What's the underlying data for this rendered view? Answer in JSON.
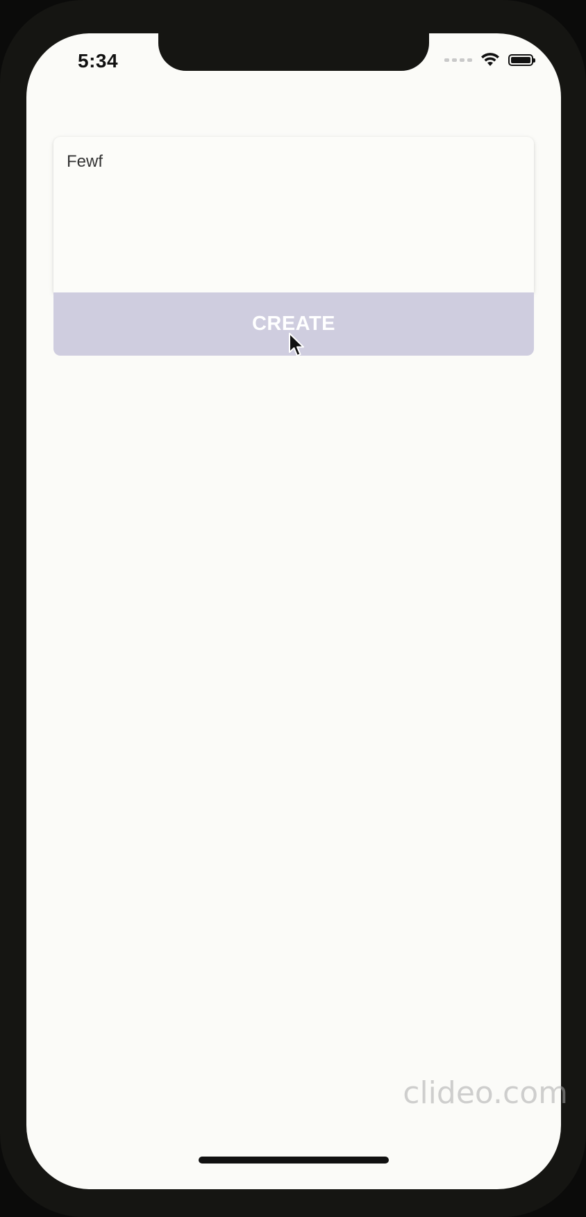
{
  "status_bar": {
    "time": "5:34"
  },
  "note": {
    "text": "Fewf"
  },
  "actions": {
    "create_label": "CREATE"
  },
  "watermark": {
    "text": "clideo.com"
  },
  "colors": {
    "screen_background": "#fbfbf8",
    "create_button_background": "#cfcddf",
    "create_button_text": "#ffffff",
    "device_frame": "#151512"
  },
  "icons": {
    "status_signal": "cellular-signal-icon",
    "status_wifi": "wifi-icon",
    "status_battery": "battery-icon",
    "pointer": "mouse-cursor-icon"
  }
}
